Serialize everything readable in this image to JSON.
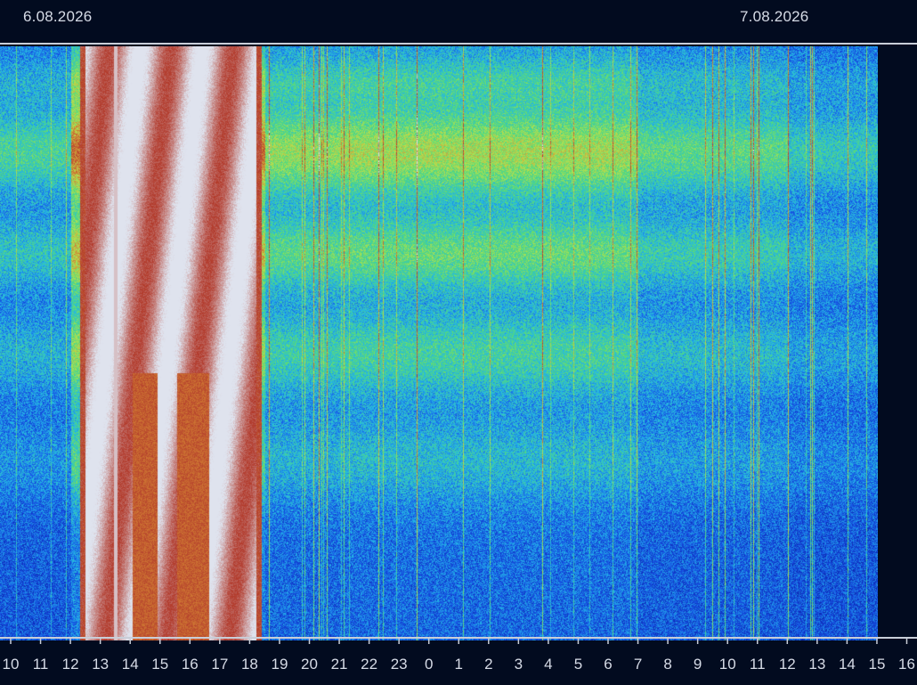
{
  "chart_data": {
    "type": "heatmap",
    "chart_kind": "spectrogram",
    "date_labels": [
      {
        "text": "6.08.2026",
        "at_hour": 10.6
      },
      {
        "text": "7.08.2026",
        "at_hour": 13.9
      }
    ],
    "x_ticks": [
      "10",
      "11",
      "12",
      "13",
      "14",
      "15",
      "16",
      "17",
      "18",
      "19",
      "20",
      "21",
      "22",
      "23",
      "0",
      "1",
      "2",
      "3",
      "4",
      "5",
      "6",
      "7",
      "8",
      "9",
      "10",
      "11",
      "12",
      "13",
      "14",
      "15",
      "16"
    ],
    "x_range_hours_elapsed": [
      0,
      30.1
    ],
    "grid": false,
    "colorscale": [
      "#0a1ea8",
      "#1757e6",
      "#24b7e6",
      "#52d97e",
      "#b7e04d",
      "#d07a33",
      "#b23a2c",
      "#dfe3ee"
    ],
    "colorscale_meaning": "low to saturated",
    "background": "#020b1f",
    "saturated_intervals_hours": [
      [
        12.3,
        18.4
      ],
      [
        13.45,
        13.55
      ]
    ],
    "activity_profile": [
      {
        "from_hour": 10,
        "to_hour": 12,
        "level": "moderate"
      },
      {
        "from_hour": 12,
        "to_hour": 18.5,
        "level": "saturated"
      },
      {
        "from_hour": 18.5,
        "to_hour": 21,
        "level": "high"
      },
      {
        "from_hour": 21,
        "to_hour": 7,
        "level": "high"
      },
      {
        "from_hour": 7,
        "to_hour": 12,
        "level": "moderate"
      },
      {
        "from_hour": 12,
        "to_hour": 13.4,
        "level": "low"
      },
      {
        "from_hour": 13.4,
        "to_hour": 13.6,
        "level": "saturated"
      },
      {
        "from_hour": 13.6,
        "to_hour": 15.1,
        "level": "low"
      }
    ]
  }
}
